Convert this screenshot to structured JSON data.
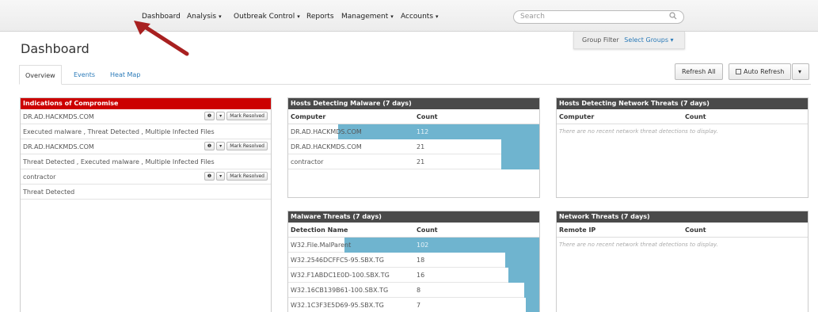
{
  "nav": {
    "items": [
      {
        "label": "Dashboard",
        "caret": ""
      },
      {
        "label": "Analysis",
        "caret": "▾"
      },
      {
        "label": "Outbreak Control",
        "caret": "▾"
      },
      {
        "label": "Reports",
        "caret": ""
      },
      {
        "label": "Management",
        "caret": "▾"
      },
      {
        "label": "Accounts",
        "caret": "▾"
      }
    ],
    "search_placeholder": "Search"
  },
  "annotation": {
    "arrow_color": "#a82020"
  },
  "page": {
    "title": "Dashboard"
  },
  "group_filter": {
    "label": "Group Filter",
    "select": "Select Groups ▾"
  },
  "tabs": [
    "Overview",
    "Events",
    "Heat Map"
  ],
  "toolbar": {
    "refresh_all": "Refresh All",
    "auto_refresh": "Auto Refresh",
    "dropdown_caret": "▾"
  },
  "colors": {
    "accent": "#2a7ab8",
    "ioc_header": "#cc0000",
    "panel_header": "#4a4a4a",
    "bar": "#6fb4cf"
  },
  "ioc_panel": {
    "title": "Indications of Compromise",
    "mark_resolved": "Mark Resolved",
    "info_glyph": "❶",
    "caret": "▾",
    "entries": [
      {
        "host": "DR.AD.HACKMDS.COM",
        "description": "Executed malware , Threat Detected , Multiple Infected Files"
      },
      {
        "host": "DR.AD.HACKMDS.COM",
        "description": "Threat Detected , Executed malware , Multiple Infected Files"
      },
      {
        "host": "contractor",
        "description": "Threat Detected"
      }
    ]
  },
  "hosts_malware": {
    "title": "Hosts Detecting Malware (7 days)",
    "col_name": "Computer",
    "col_count": "Count",
    "max": 112,
    "rows": [
      {
        "name": "DR.AD.HACKMDS.COM",
        "count": "112",
        "value": 112
      },
      {
        "name": "DR.AD.HACKMDS.COM",
        "count": "21",
        "value": 21
      },
      {
        "name": "contractor",
        "count": "21",
        "value": 21
      }
    ]
  },
  "hosts_network": {
    "title": "Hosts Detecting Network Threats (7 days)",
    "col_name": "Computer",
    "col_count": "Count",
    "empty": "There are no recent network threat detections to display."
  },
  "malware_threats": {
    "title": "Malware Threats (7 days)",
    "col_name": "Detection Name",
    "col_count": "Count",
    "max": 102,
    "rows": [
      {
        "name": "W32.File.MalParent",
        "count": "102",
        "value": 102
      },
      {
        "name": "W32.2546DCFFC5-95.SBX.TG",
        "count": "18",
        "value": 18
      },
      {
        "name": "W32.F1ABDC1E0D-100.SBX.TG",
        "count": "16",
        "value": 16
      },
      {
        "name": "W32.16CB139B61-100.SBX.TG",
        "count": "8",
        "value": 8
      },
      {
        "name": "W32.1C3F3E5D69-95.SBX.TG",
        "count": "7",
        "value": 7
      }
    ]
  },
  "network_threats": {
    "title": "Network Threats (7 days)",
    "col_name": "Remote IP",
    "col_count": "Count",
    "empty": "There are no recent network threat detections to display."
  }
}
